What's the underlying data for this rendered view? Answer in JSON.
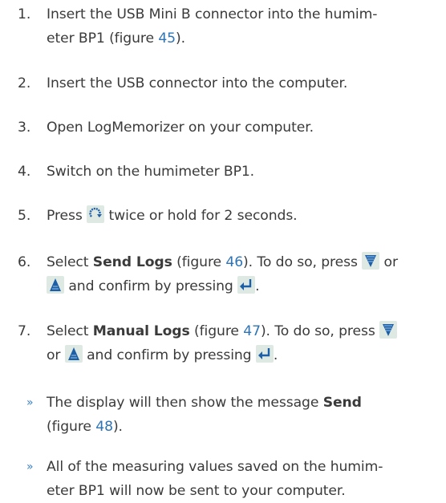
{
  "steps": [
    {
      "num": "1.",
      "a": "Insert the USB Mini B connector into the humim-",
      "b": "eter BP1 (figure ",
      "ref": "45",
      "c": ")."
    },
    {
      "num": "2.",
      "text": "Insert the USB connector into the computer."
    },
    {
      "num": "3.",
      "text": "Open LogMemorizer on your computer."
    },
    {
      "num": "4.",
      "text": "Switch on the humimeter BP1."
    },
    {
      "num": "5.",
      "a": "Press ",
      "b": " twice or hold for 2 seconds."
    },
    {
      "num": "6.",
      "a": "Select ",
      "bold": "Send Logs",
      "b": " (figure ",
      "ref": "46",
      "c": "). To do so, press ",
      "d": " or",
      "e": " and confirm by pressing ",
      "f": "."
    },
    {
      "num": "7.",
      "a": "Select ",
      "bold": "Manual Logs",
      "b": " (figure ",
      "ref": "47",
      "c": "). To do so, press ",
      "d": "or ",
      "e": " and confirm by pressing ",
      "f": "."
    }
  ],
  "notes": [
    {
      "bullet": "»",
      "a": "The display will then show the message ",
      "bold": "Send",
      "b": "(figure ",
      "ref": "48",
      "c": ")."
    },
    {
      "bullet": "»",
      "a": "All of the measuring values saved on the humim-",
      "b": "eter BP1 will now be sent to your computer."
    }
  ],
  "icons": [
    "rotate-arrow-icon",
    "down-arrow-icon",
    "up-arrow-icon",
    "enter-icon"
  ],
  "colors": {
    "text": "#3a3a3a",
    "link": "#2e74b5",
    "icon_bg": "#dfe9e3",
    "icon_fg": "#1d5fa6"
  }
}
